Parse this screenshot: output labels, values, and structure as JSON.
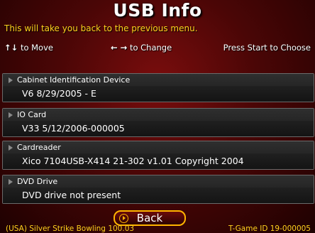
{
  "screen": {
    "title": "USB Info",
    "hint": "This will take you back to the previous menu."
  },
  "controls": {
    "move_icon": "↑↓",
    "move_label": "to Move",
    "change_icon": "← →",
    "change_label": "to Change",
    "choose_label": "Press Start to Choose"
  },
  "devices": [
    {
      "label": "Cabinet Identification Device",
      "value": "V6 8/29/2005 - E"
    },
    {
      "label": "IO Card",
      "value": "V33 5/12/2006-000005"
    },
    {
      "label": "Cardreader",
      "value": "Xico 7104USB-X414 21-302 v1.01 Copyright 2004"
    },
    {
      "label": "DVD Drive",
      "value": "DVD drive not present"
    }
  ],
  "back_button": {
    "label": "Back"
  },
  "footer": {
    "left": "(USA) Silver Strike Bowling 100.03",
    "right": "T-Game ID 19-000005"
  },
  "colors": {
    "background": "#5a0808",
    "accent_yellow": "#ffd21e",
    "button_border": "#ffb400"
  }
}
